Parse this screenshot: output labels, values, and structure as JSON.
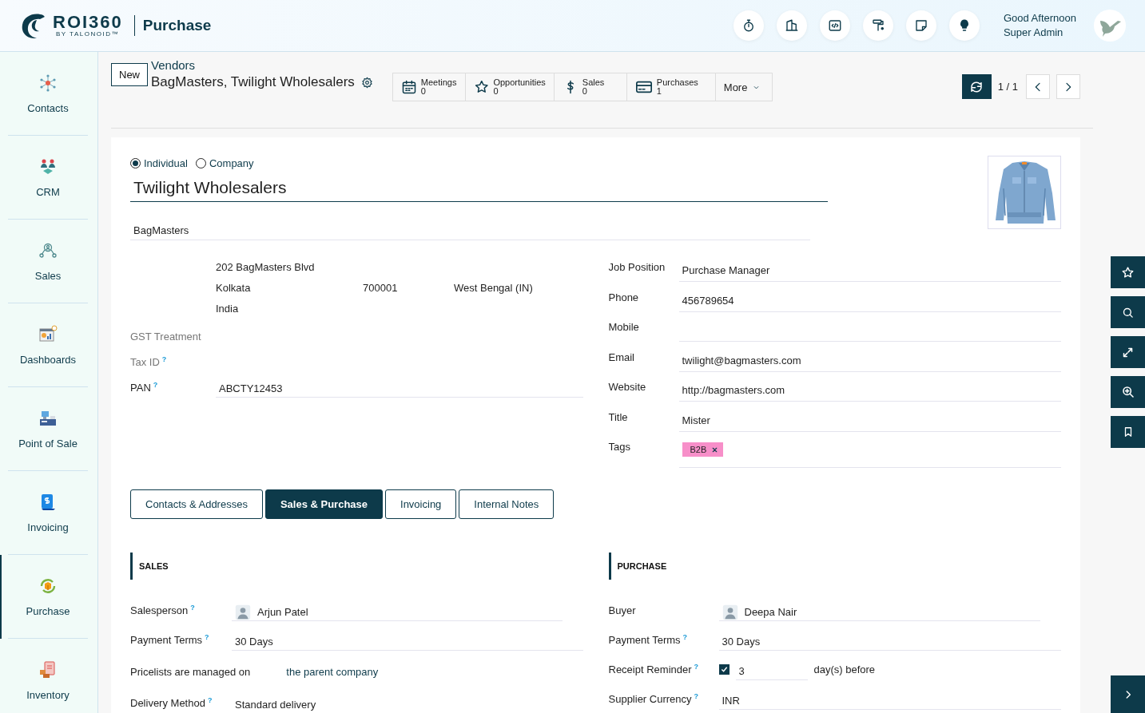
{
  "header": {
    "logo": {
      "name": "ROI360",
      "tagline": "BY TALONOID™"
    },
    "app_title": "Purchase",
    "greeting": "Good Afternoon",
    "user": "Super Admin"
  },
  "sidebar": {
    "items": [
      {
        "label": "Contacts",
        "selected": false
      },
      {
        "label": "CRM",
        "selected": false
      },
      {
        "label": "Sales",
        "selected": false
      },
      {
        "label": "Dashboards",
        "selected": false
      },
      {
        "label": "Point of Sale",
        "selected": false
      },
      {
        "label": "Invoicing",
        "selected": false
      },
      {
        "label": "Purchase",
        "selected": true
      },
      {
        "label": "Inventory",
        "selected": false
      }
    ]
  },
  "control_panel": {
    "new_button": "New",
    "breadcrumb": "Vendors",
    "record_title": "BagMasters, Twilight Wholesalers",
    "smart_buttons": [
      {
        "label": "Meetings",
        "count": "0"
      },
      {
        "label": "Opportunities",
        "count": "0"
      },
      {
        "label": "Sales",
        "count": "0"
      },
      {
        "label": "Purchases",
        "count": "1"
      }
    ],
    "more": "More",
    "pager": "1 / 1"
  },
  "form": {
    "type_options": [
      {
        "label": "Individual",
        "selected": true
      },
      {
        "label": "Company",
        "selected": false
      }
    ],
    "name": "Twilight Wholesalers",
    "company": "BagMasters",
    "address": {
      "street": "202 BagMasters Blvd",
      "city": "Kolkata",
      "zip": "700001",
      "state": "West Bengal (IN)",
      "country": "India"
    },
    "left_fields": [
      {
        "label": "GST Treatment",
        "disabled": true
      },
      {
        "label": "Tax ID",
        "help": "?",
        "disabled": true
      },
      {
        "label": "PAN",
        "help": "?",
        "value": "ABCTY12453",
        "disabled": false
      }
    ],
    "right_fields": [
      {
        "kind": "text",
        "label": "Job Position",
        "value": "Purchase Manager"
      },
      {
        "kind": "text",
        "label": "Phone",
        "value": "456789654"
      },
      {
        "kind": "text",
        "label": "Mobile"
      },
      {
        "kind": "text",
        "label": "Email",
        "value": "twilight@bagmasters.com"
      },
      {
        "kind": "text",
        "label": "Website",
        "value": "http://bagmasters.com"
      },
      {
        "kind": "text",
        "label": "Title",
        "value": "Mister"
      },
      {
        "kind": "tags",
        "label": "Tags",
        "tags": [
          {
            "label": "B2B",
            "color": "#f78fc9"
          }
        ]
      }
    ],
    "tabs": [
      {
        "label": "Contacts & Addresses",
        "selected": false
      },
      {
        "label": "Sales & Purchase",
        "selected": true
      },
      {
        "label": "Invoicing",
        "selected": false
      },
      {
        "label": "Internal Notes",
        "selected": false
      }
    ],
    "sales": {
      "heading": "SALES",
      "rows": [
        {
          "kind": "avatar",
          "label": "Salesperson",
          "help": "?",
          "value": "Arjun Patel"
        },
        {
          "kind": "text",
          "label": "Payment Terms",
          "help": "?",
          "value": "30 Days"
        },
        {
          "kind": "link",
          "label": "Pricelists are managed on",
          "value": "the parent company"
        },
        {
          "kind": "text",
          "label": "Delivery Method",
          "help": "?",
          "value": "Standard delivery"
        }
      ]
    },
    "purchase": {
      "heading": "PURCHASE",
      "rows": [
        {
          "kind": "avatar",
          "label": "Buyer",
          "value": "Deepa Nair"
        },
        {
          "kind": "text",
          "label": "Payment Terms",
          "help": "?",
          "value": "30 Days"
        },
        {
          "kind": "reminder",
          "label": "Receipt Reminder",
          "help": "?",
          "checked": true,
          "value": "3",
          "suffix": "day(s) before"
        },
        {
          "kind": "text",
          "label": "Supplier Currency",
          "help": "?",
          "value": "INR"
        }
      ]
    }
  }
}
